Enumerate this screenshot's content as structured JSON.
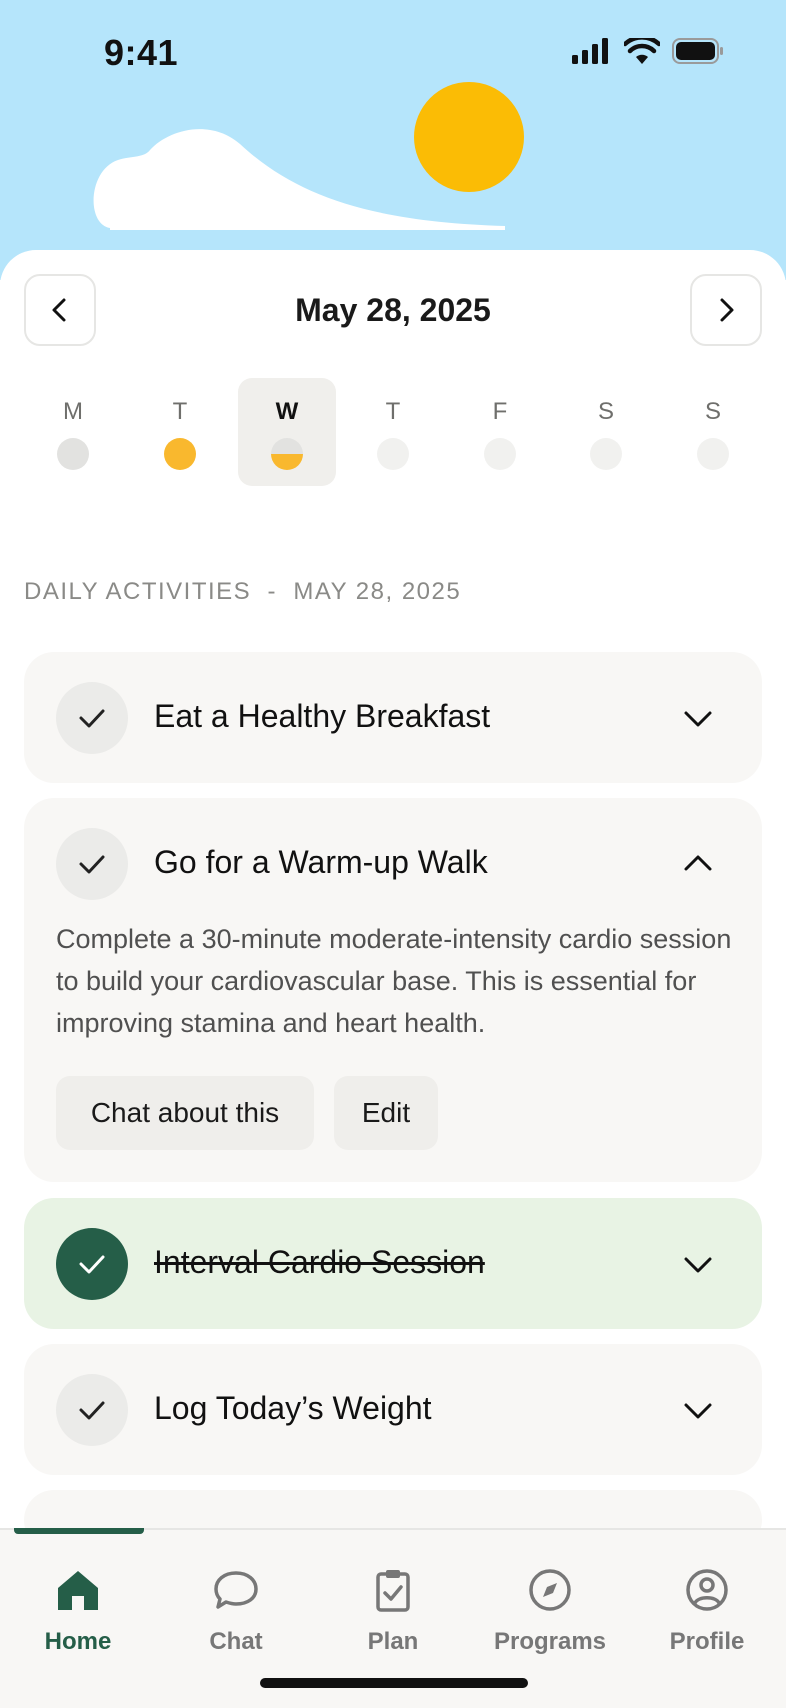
{
  "status_bar": {
    "time": "9:41"
  },
  "date_nav": {
    "title": "May 28, 2025"
  },
  "week": [
    {
      "letter": "M",
      "status": "grey"
    },
    {
      "letter": "T",
      "status": "full"
    },
    {
      "letter": "W",
      "status": "half",
      "selected": true
    },
    {
      "letter": "T",
      "status": "empty"
    },
    {
      "letter": "F",
      "status": "empty"
    },
    {
      "letter": "S",
      "status": "empty"
    },
    {
      "letter": "S",
      "status": "empty"
    }
  ],
  "section": {
    "label": "DAILY ACTIVITIES  -  MAY 28, 2025"
  },
  "activities": [
    {
      "title": "Eat a Healthy Breakfast",
      "completed": false,
      "expanded": false
    },
    {
      "title": "Go for a Warm-up Walk",
      "completed": false,
      "expanded": true,
      "description": "Complete a 30-minute moderate-intensity cardio session to build your cardiovascular base. This is essential for improving stamina and heart health.",
      "actions": [
        "Chat about this",
        "Edit"
      ]
    },
    {
      "title": "Interval Cardio Session",
      "completed": true,
      "expanded": false
    },
    {
      "title": "Log Today’s Weight",
      "completed": false,
      "expanded": false
    }
  ],
  "tabbar": {
    "tabs": [
      {
        "label": "Home",
        "icon": "home-icon",
        "active": true
      },
      {
        "label": "Chat",
        "icon": "chat-bubble-icon"
      },
      {
        "label": "Plan",
        "icon": "clipboard-check-icon"
      },
      {
        "label": "Programs",
        "icon": "compass-icon"
      },
      {
        "label": "Profile",
        "icon": "user-circle-icon"
      }
    ]
  },
  "colors": {
    "sky": "#b5e5fb",
    "sun": "#fbbc05",
    "accent_green": "#255e48",
    "completed_bg": "#e8f3e4",
    "progress_orange": "#f9b82e"
  }
}
